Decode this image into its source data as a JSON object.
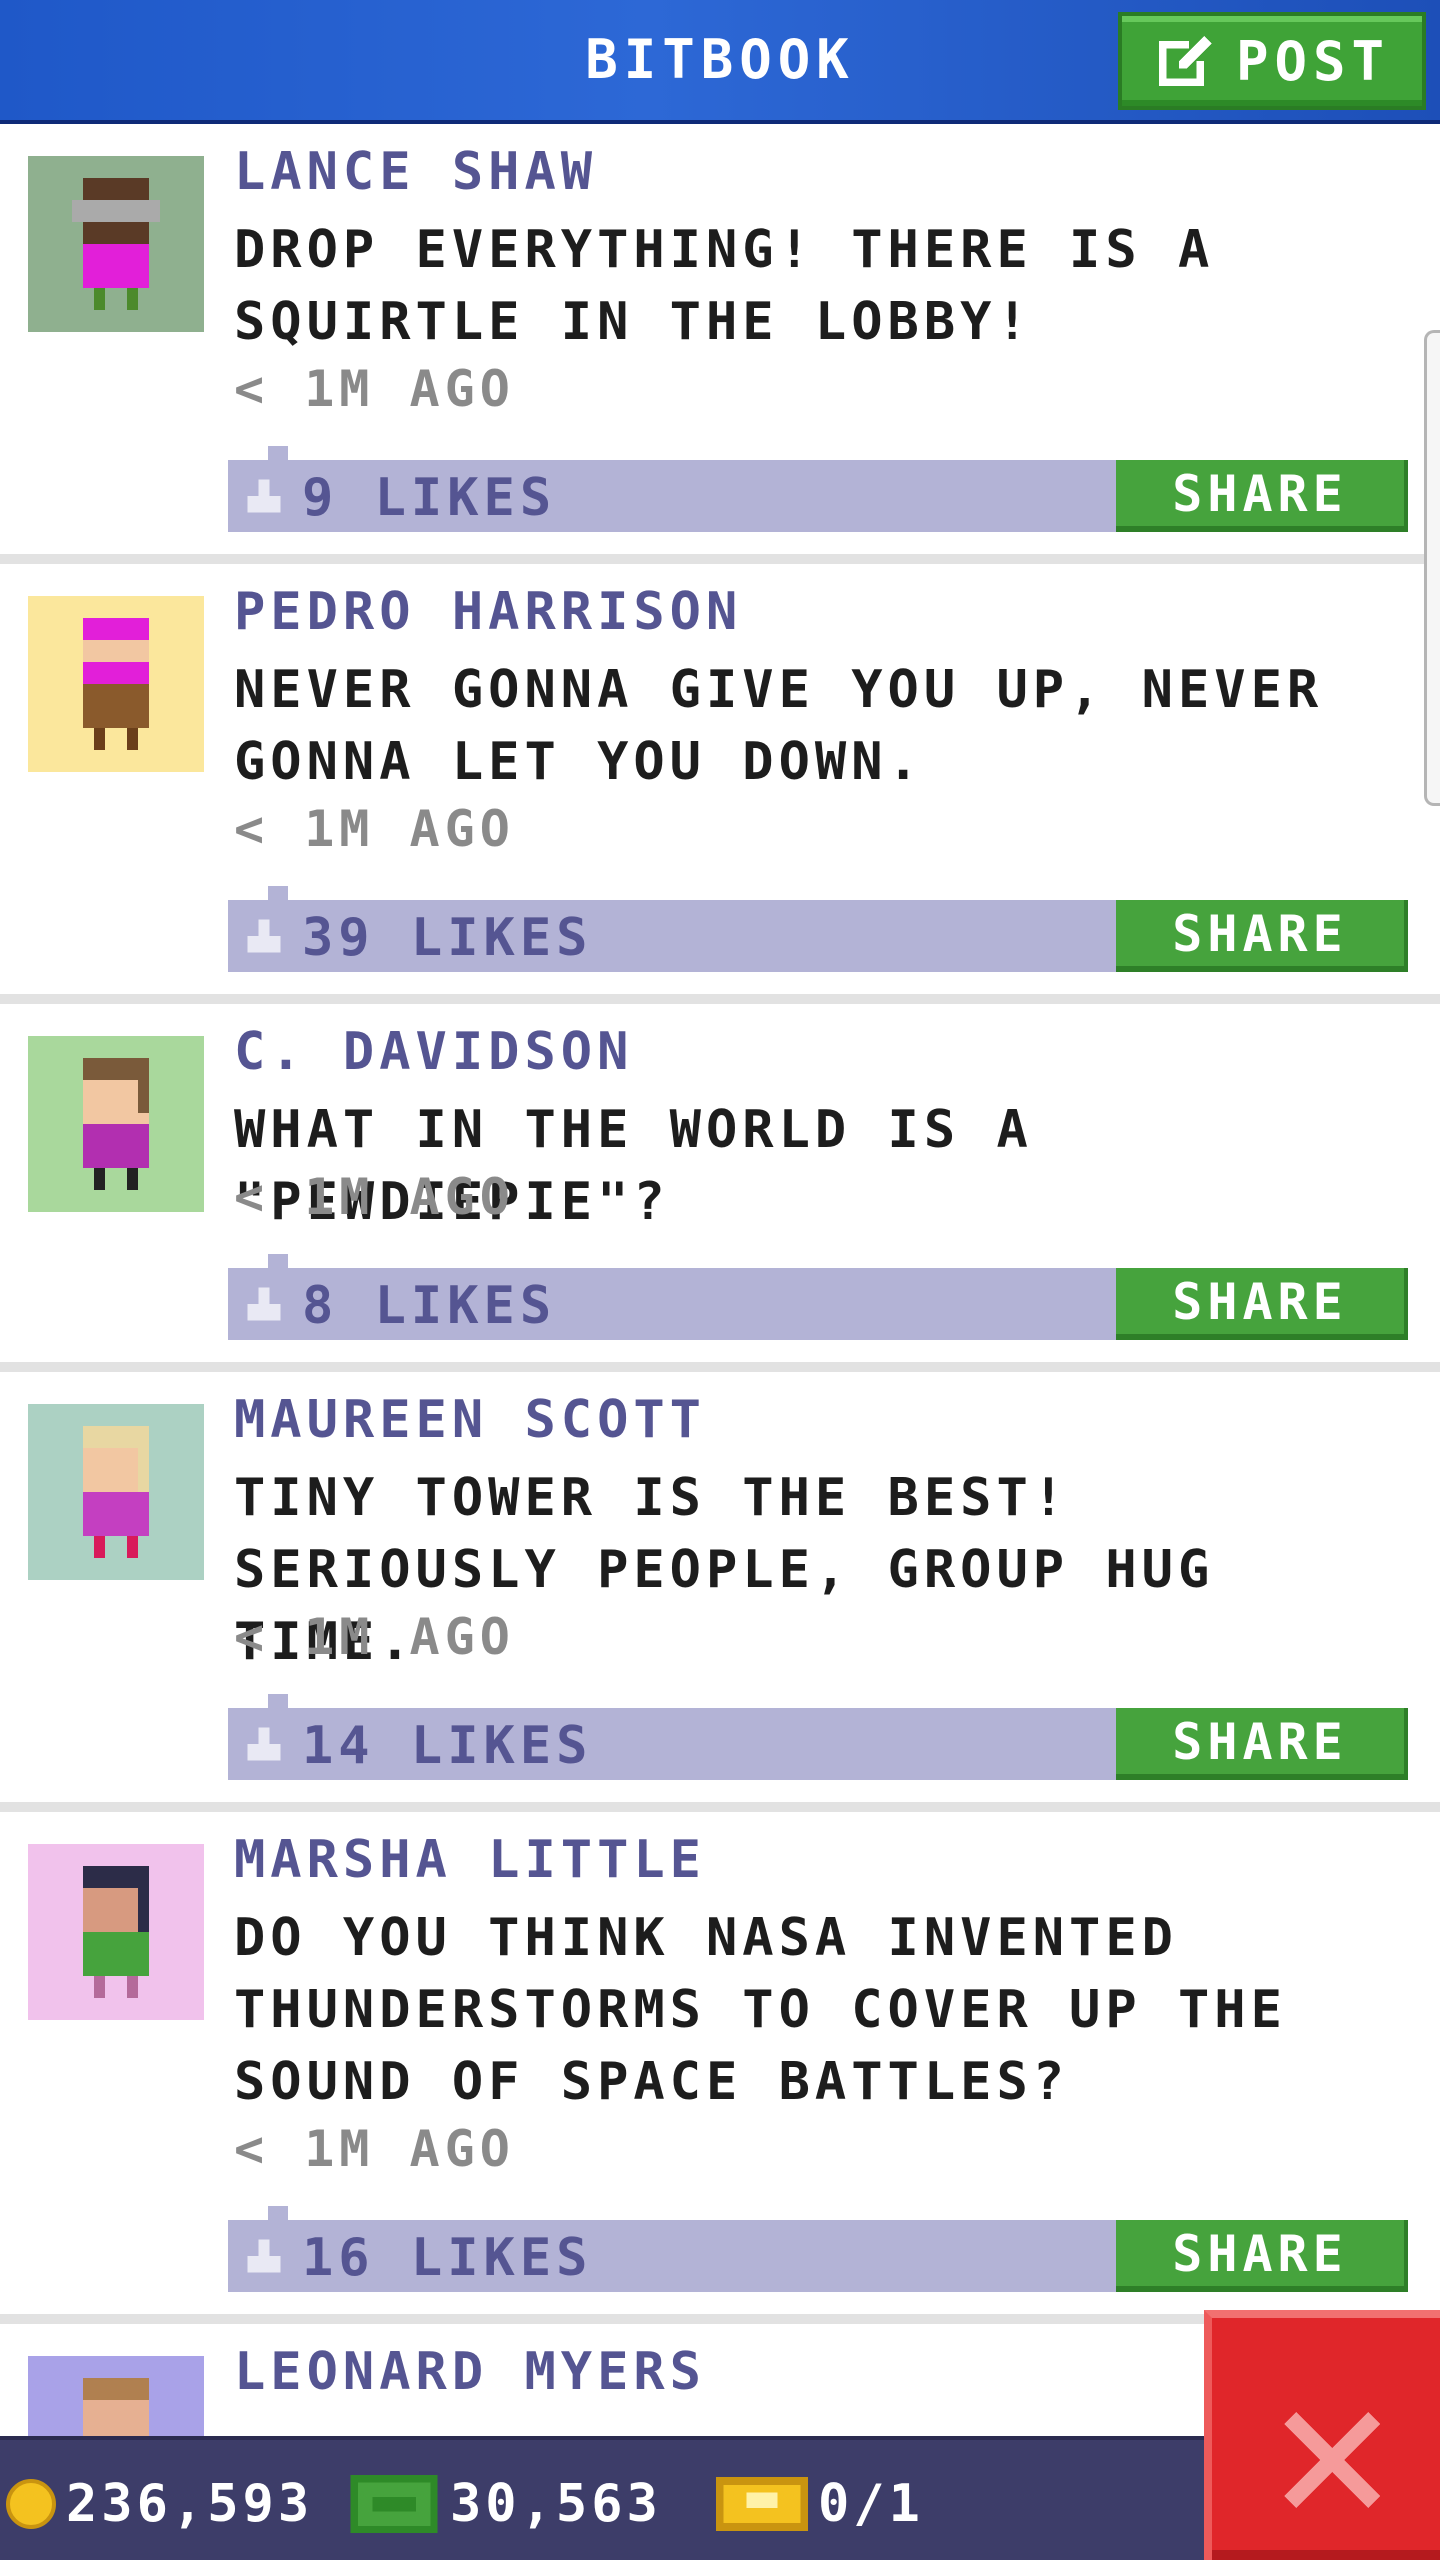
{
  "header": {
    "title": "BITBOOK",
    "post_label": "POST"
  },
  "posts": [
    {
      "author": "LANCE SHAW",
      "message": "DROP EVERYTHING! THERE IS A SQUIRTLE IN THE LOBBY!",
      "time": "< 1M AGO",
      "likes": "9 LIKES",
      "share": "SHARE",
      "avatar_bg": "#8fb08f",
      "avatar_icon": "bitizen-bald-grey-hair-icon"
    },
    {
      "author": "PEDRO HARRISON",
      "message": "NEVER GONNA GIVE YOU UP, NEVER GONNA LET YOU DOWN.",
      "time": "< 1M AGO",
      "likes": "39 LIKES",
      "share": "SHARE",
      "avatar_bg": "#fbe79c",
      "avatar_icon": "bitizen-pink-hair-icon"
    },
    {
      "author": "C. DAVIDSON",
      "message": "WHAT IN THE WORLD IS A \"PEWDIEPIE\"?",
      "time": "< 1M AGO",
      "likes": "8 LIKES",
      "share": "SHARE",
      "avatar_bg": "#a9d89c",
      "avatar_icon": "bitizen-brown-hair-icon"
    },
    {
      "author": "MAUREEN SCOTT",
      "message": "TINY TOWER IS THE BEST! SERIOUSLY PEOPLE, GROUP HUG TIME.",
      "time": "< 1M AGO",
      "likes": "14 LIKES",
      "share": "SHARE",
      "avatar_bg": "#acd1c3",
      "avatar_icon": "bitizen-blonde-hair-icon"
    },
    {
      "author": "MARSHA LITTLE",
      "message": "DO YOU THINK NASA INVENTED THUNDERSTORMS TO COVER UP THE SOUND OF SPACE BATTLES?",
      "time": "< 1M AGO",
      "likes": "16 LIKES",
      "share": "SHARE",
      "avatar_bg": "#f1c2ec",
      "avatar_icon": "bitizen-dark-hair-icon"
    },
    {
      "author": "LEONARD MYERS",
      "message": "",
      "time": "",
      "likes": "",
      "share": "",
      "avatar_bg": "#a9a2e8",
      "avatar_icon": "bitizen-partial-icon"
    }
  ],
  "status": {
    "coins": "236,593",
    "bux": "30,563",
    "tickets": "0/1"
  },
  "colors": {
    "header": "#2d68d6",
    "share": "#46a33d",
    "likes_bar": "#b3b3d6",
    "close": "#e0262a"
  }
}
